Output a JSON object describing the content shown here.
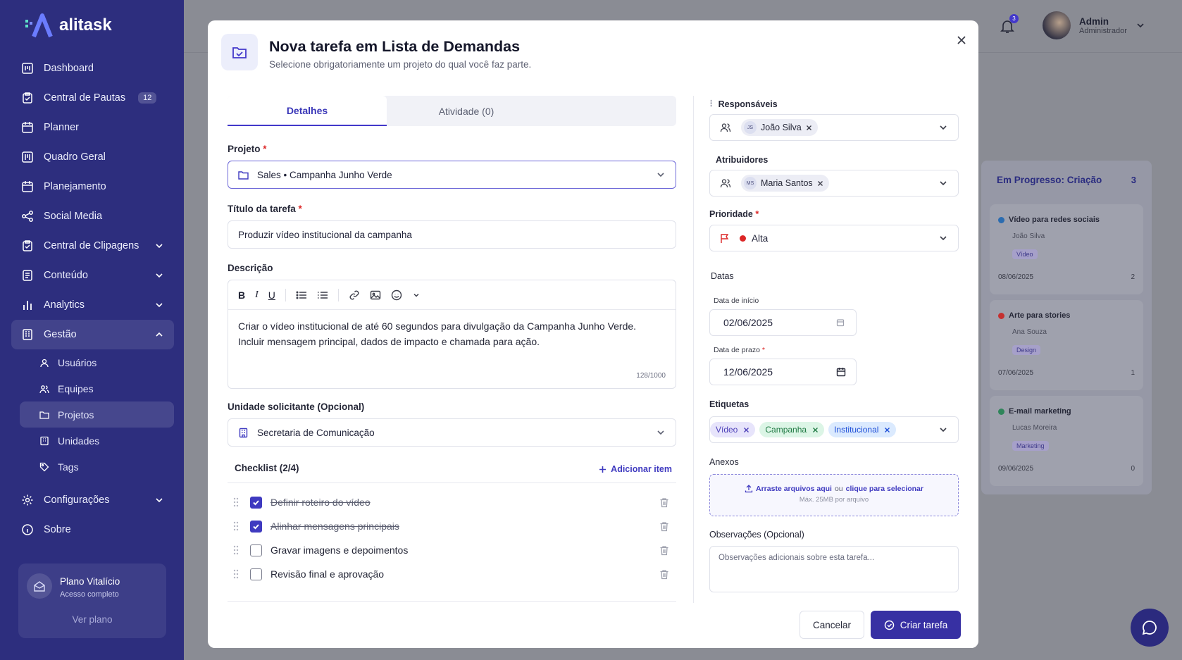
{
  "app": {
    "brand": "alitask"
  },
  "sidebar": {
    "items": [
      {
        "label": "Dashboard",
        "icon": "dashboard-icon"
      },
      {
        "label": "Central de Pautas",
        "icon": "clipboard-icon",
        "count": "12"
      },
      {
        "label": "Planner",
        "icon": "calendar-icon"
      },
      {
        "label": "Quadro Geral",
        "icon": "board-icon"
      },
      {
        "label": "Planejamento",
        "icon": "calendar-icon"
      },
      {
        "label": "Social Media",
        "icon": "share-icon"
      },
      {
        "label": "Central de Clipagens",
        "icon": "clipboard-icon"
      },
      {
        "label": "Conteúdo",
        "icon": "document-icon"
      },
      {
        "label": "Analytics",
        "icon": "bar-chart-icon"
      },
      {
        "label": "Gestão",
        "icon": "building-icon"
      }
    ],
    "subitems": [
      {
        "label": "Usuários"
      },
      {
        "label": "Equipes"
      },
      {
        "label": "Projetos"
      },
      {
        "label": "Unidades"
      },
      {
        "label": "Tags"
      }
    ],
    "bottom": [
      {
        "label": "Configurações"
      },
      {
        "label": "Sobre"
      }
    ],
    "plan": {
      "title": "Plano Vitalício",
      "subtitle": "Acesso completo",
      "button": "Ver plano"
    }
  },
  "topbar": {
    "notifications": "3",
    "user_name": "Admin",
    "user_role": "Administrador"
  },
  "kanban": {
    "title": "Em Progresso: Criação",
    "count": "3",
    "cards": [
      {
        "title": "Vídeo para redes sociais",
        "assignee": "João Silva",
        "tag": "Vídeo",
        "date": "08/06/2025",
        "comments": "2",
        "color": "#2b6cb0"
      },
      {
        "title": "Arte para stories",
        "assignee": "Ana Souza",
        "tag": "Design",
        "date": "07/06/2025",
        "comments": "1",
        "color": "#c53030"
      },
      {
        "title": "E-mail marketing",
        "assignee": "Lucas Moreira",
        "tag": "Marketing",
        "date": "09/06/2025",
        "comments": "0",
        "color": "#2f855a"
      }
    ]
  },
  "modal": {
    "title": "Nova tarefa em Lista de Demandas",
    "subtitle": "Selecione obrigatoriamente um projeto do qual você faz parte.",
    "tabs": [
      "Detalhes",
      "Atividade (0)"
    ],
    "project": {
      "label": "Projeto",
      "value": "Sales • Campanha Junho Verde"
    },
    "task_title": {
      "label": "Título da tarefa",
      "value": "Produzir vídeo institucional da campanha"
    },
    "description": {
      "label": "Descrição",
      "line1": "Criar o vídeo institucional de até 60 segundos para divulgação da Campanha Junho Verde.",
      "line2": "Incluir mensagem principal, dados de impacto e chamada para ação.",
      "count": "128/1000"
    },
    "unit": {
      "label": "Unidade solicitante (Opcional)",
      "value": "Secretaria de Comunicação"
    },
    "checklist": {
      "title": "Checklist (2/4)",
      "add": "Adicionar item",
      "items": [
        {
          "label": "Definir roteiro do vídeo",
          "done": true
        },
        {
          "label": "Alinhar mensagens principais",
          "done": true
        },
        {
          "label": "Gravar imagens e depoimentos",
          "done": false
        },
        {
          "label": "Revisão final e aprovação",
          "done": false
        }
      ]
    },
    "responsaveis": {
      "label": "Responsáveis",
      "initials": "JS",
      "name": "João Silva"
    },
    "atribuidores": {
      "label": "Atribuidores",
      "initials": "MS",
      "name": "Maria Santos"
    },
    "prioridade": {
      "label": "Prioridade",
      "value": "Alta",
      "color": "#dc2626"
    },
    "datas": {
      "label": "Datas",
      "start_label": "Data de início",
      "start": "02/06/2025",
      "due_label": "Data de prazo",
      "due": "12/06/2025"
    },
    "etiquetas": {
      "label": "Etiquetas",
      "tags": [
        {
          "name": "Vídeo",
          "bg": "#e7e4fb",
          "fg": "#4c3fb8"
        },
        {
          "name": "Campanha",
          "bg": "#dcf5e6",
          "fg": "#1f7a43"
        },
        {
          "name": "Institucional",
          "bg": "#dbeafe",
          "fg": "#1d4ed8"
        }
      ]
    },
    "anexos": {
      "label": "Anexos",
      "drag": "Arraste arquivos aqui",
      "or": "ou",
      "click": "clique para selecionar",
      "max": "Máx. 25MB por arquivo"
    },
    "observacoes": {
      "label": "Observações (Opcional)",
      "placeholder": "Observações adicionais sobre esta tarefa..."
    },
    "cancel": "Cancelar",
    "create": "Criar tarefa"
  }
}
